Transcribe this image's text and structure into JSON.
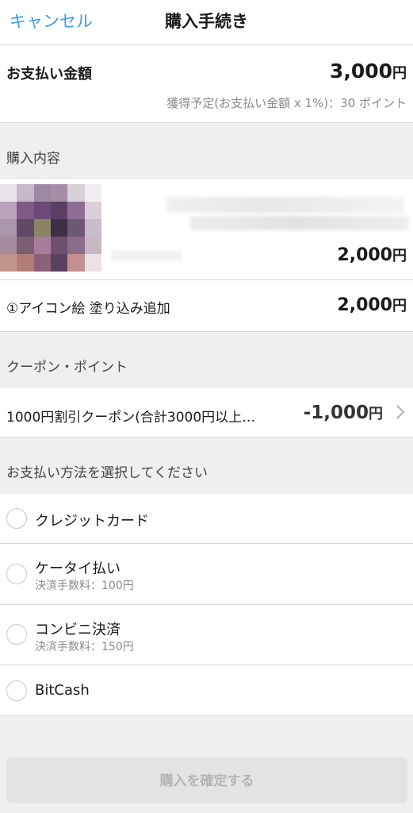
{
  "nav": {
    "cancel_label": "キャンセル",
    "title": "購入手続き"
  },
  "amount": {
    "label": "お支払い金額",
    "value": "3,000",
    "currency": "円",
    "points_text": "獲得予定(お支払い金額 x 1%)：30 ポイント"
  },
  "purchase": {
    "section_title": "購入内容",
    "product_price": "2,000",
    "currency": "円",
    "option_label": "①アイコン絵 塗り込み追加",
    "option_price": "2,000"
  },
  "coupon": {
    "section_title": "クーポン・ポイント",
    "label": "1000円割引クーポン(合計3000円以上…",
    "amount": "-1,000",
    "currency": "円"
  },
  "payment": {
    "section_title": "お支払い方法を選択してください",
    "methods": [
      {
        "name": "クレジットカード",
        "fee": ""
      },
      {
        "name": "ケータイ払い",
        "fee": "決済手数料：100円"
      },
      {
        "name": "コンビニ決済",
        "fee": "決済手数料：150円"
      },
      {
        "name": "BitCash",
        "fee": ""
      }
    ]
  },
  "confirm_label": "購入を確定する",
  "colors": {
    "accent": "#3a9be8",
    "background": "#efeff0",
    "disabled_button": "#e3e3e3"
  }
}
